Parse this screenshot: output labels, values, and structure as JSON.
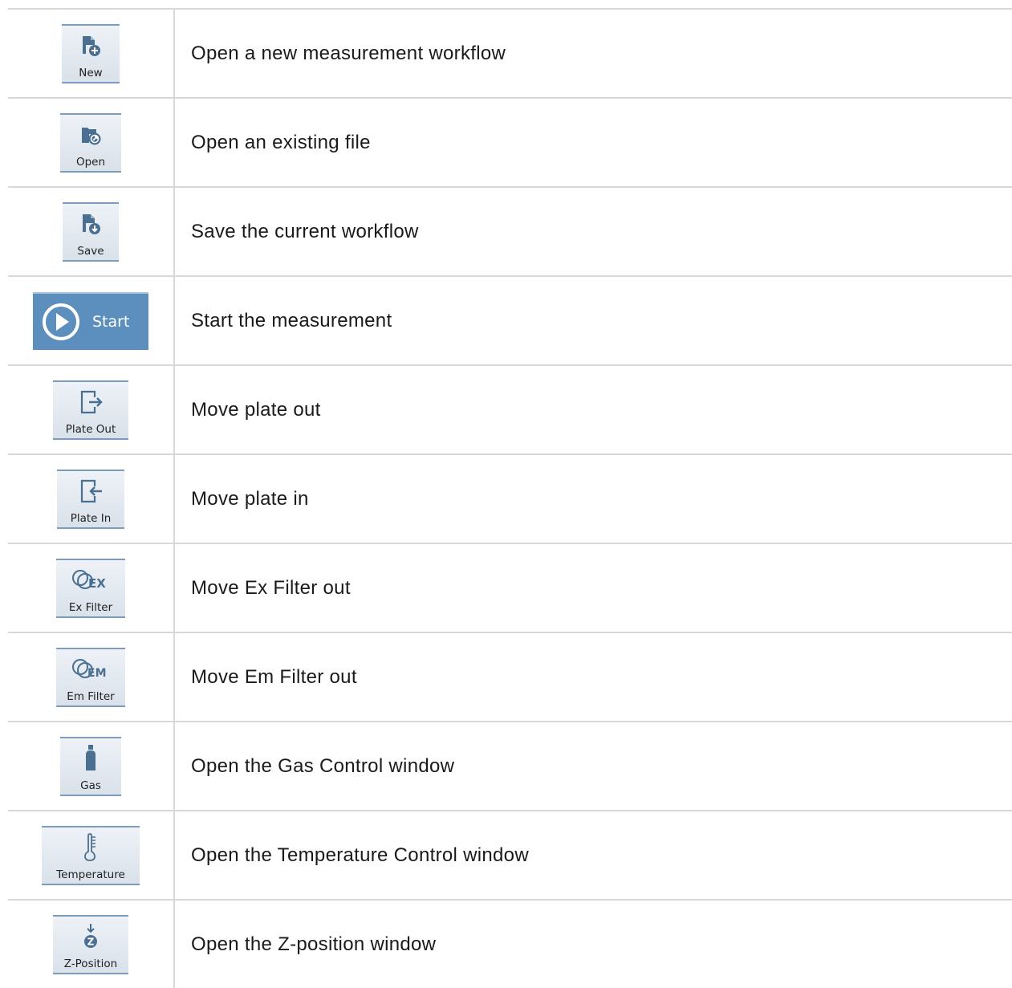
{
  "rows": [
    {
      "button": "New",
      "icon": "new-file-icon",
      "description": "Open a new measurement workflow"
    },
    {
      "button": "Open",
      "icon": "open-folder-icon",
      "description": "Open an existing file"
    },
    {
      "button": "Save",
      "icon": "save-file-icon",
      "description": "Save the current workflow"
    },
    {
      "button": "Start",
      "icon": "play-icon",
      "description": "Start the measurement"
    },
    {
      "button": "Plate Out",
      "icon": "plate-out-icon",
      "description": "Move plate out"
    },
    {
      "button": "Plate In",
      "icon": "plate-in-icon",
      "description": "Move plate in"
    },
    {
      "button": "Ex Filter",
      "icon": "ex-filter-icon",
      "description": "Move Ex Filter out"
    },
    {
      "button": "Em Filter",
      "icon": "em-filter-icon",
      "description": "Move Em Filter out"
    },
    {
      "button": "Gas",
      "icon": "gas-bottle-icon",
      "description": "Open the Gas Control window"
    },
    {
      "button": "Temperature",
      "icon": "thermometer-icon",
      "description": "Open the Temperature Control window"
    },
    {
      "button": "Z-Position",
      "icon": "z-position-icon",
      "description": "Open the Z-position window"
    }
  ],
  "colors": {
    "icon": "#4a6f91",
    "start_bg": "#5c8fbd",
    "button_border": "#7d9cbc",
    "grid": "#d8d8d8"
  }
}
